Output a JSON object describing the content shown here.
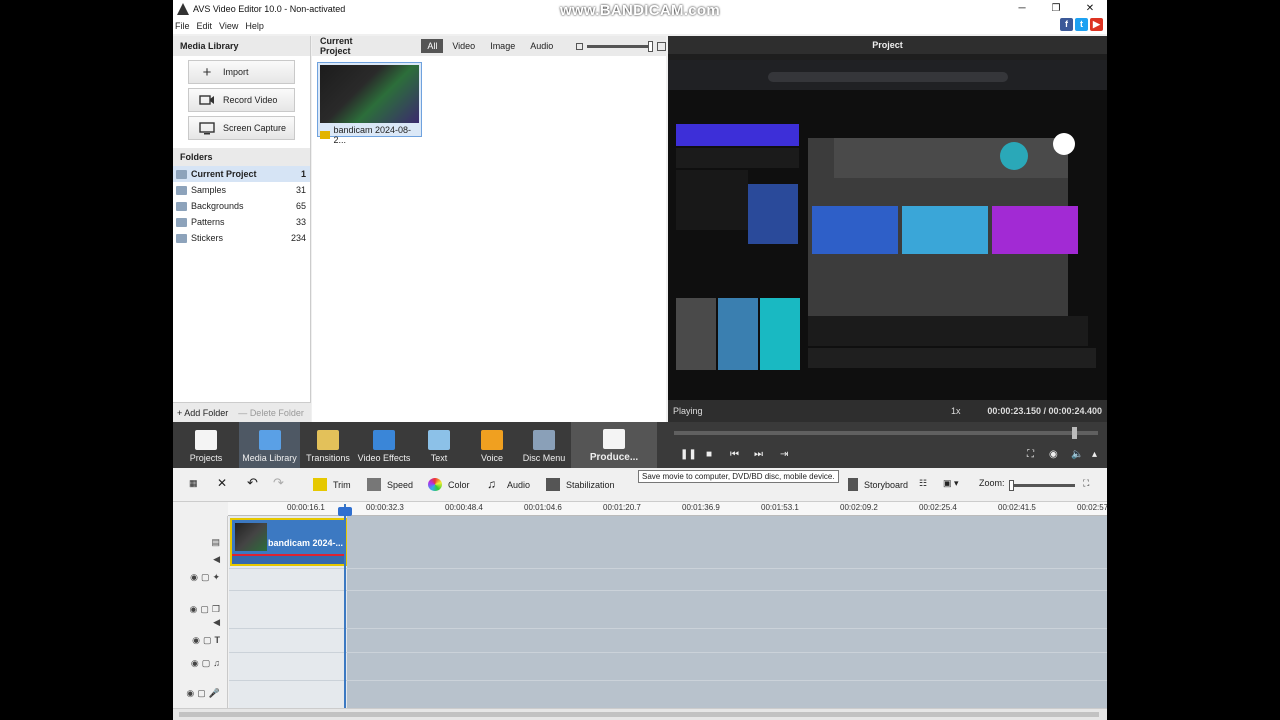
{
  "watermark": "www.BANDICAM.com",
  "window": {
    "title": "AVS Video Editor 10.0 - Non-activated",
    "controls": [
      "─",
      "❐",
      "✕"
    ]
  },
  "menu": [
    "File",
    "Edit",
    "View",
    "Help"
  ],
  "social": [
    "f",
    "t",
    "▶"
  ],
  "library": {
    "title": "Media Library",
    "buttons": [
      {
        "label": "Import",
        "icon": "plus-icon"
      },
      {
        "label": "Record Video",
        "icon": "video-camera-icon"
      },
      {
        "label": "Screen Capture",
        "icon": "monitor-icon"
      }
    ],
    "folders_title": "Folders",
    "folders": [
      {
        "name": "Current Project",
        "count": "1"
      },
      {
        "name": "Samples",
        "count": "31"
      },
      {
        "name": "Backgrounds",
        "count": "65"
      },
      {
        "name": "Patterns",
        "count": "33"
      },
      {
        "name": "Stickers",
        "count": "234"
      }
    ],
    "add_folder": "Add Folder",
    "delete_folder": "Delete Folder"
  },
  "project": {
    "title": "Current Project",
    "tabs": [
      "All",
      "Video",
      "Image",
      "Audio"
    ],
    "active_tab": "All",
    "item_label": "bandicam 2024-08-2..."
  },
  "preview": {
    "title": "Project",
    "status": "Playing",
    "speed": "1x",
    "time": "00:00:23.150 / 00:00:24.400",
    "playback_progress": 0.949
  },
  "toolbar": {
    "items": [
      {
        "label": "Projects",
        "color": "#f4f4f4"
      },
      {
        "label": "Media Library",
        "color": "#5aa0e6"
      },
      {
        "label": "Transitions",
        "color": "#e3c15a"
      },
      {
        "label": "Video Effects",
        "color": "#3a86d8"
      },
      {
        "label": "Text",
        "color": "#8cc1e8"
      },
      {
        "label": "Voice",
        "color": "#f0a020"
      },
      {
        "label": "Disc Menu",
        "color": "#8aa0b8"
      }
    ],
    "produce": "Produce..."
  },
  "tooltip": "Save movie to computer, DVD/BD disc, mobile device.",
  "edit_toolbar": {
    "trim": "Trim",
    "speed": "Speed",
    "color": "Color",
    "audio": "Audio",
    "stabilization": "Stabilization",
    "storyboard": "Storyboard",
    "zoom": "Zoom:"
  },
  "timeline": {
    "ticks": [
      "00:00:16.1",
      "00:00:32.3",
      "00:00:48.4",
      "00:01:04.6",
      "00:01:20.7",
      "00:01:36.9",
      "00:01:53.1",
      "00:02:09.2",
      "00:02:25.4",
      "00:02:41.5",
      "00:02:57"
    ],
    "clip_label": "bandicam 2024-..."
  },
  "colors": {
    "accent": "#3c79c2",
    "dark_toolbar": "#3a3a3a",
    "clip_border": "#e6c800"
  }
}
